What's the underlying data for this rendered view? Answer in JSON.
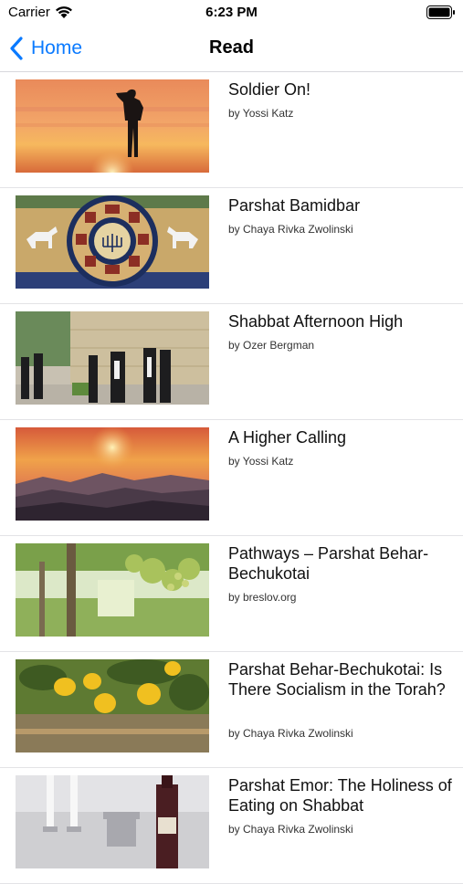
{
  "status": {
    "carrier": "Carrier",
    "time": "6:23 PM"
  },
  "nav": {
    "back_label": "Home",
    "title": "Read"
  },
  "articles": [
    {
      "title": "Soldier On!",
      "author": "by Yossi Katz",
      "image": "soldier-salute-sunset"
    },
    {
      "title": "Parshat Bamidbar",
      "author": "by Chaya Rivka Zwolinski",
      "image": "tribes-mosaic"
    },
    {
      "title": "Shabbat Afternoon High",
      "author": "by Ozer Bergman",
      "image": "jerusalem-street"
    },
    {
      "title": "A Higher Calling",
      "author": "by Yossi Katz",
      "image": "mountain-sunset"
    },
    {
      "title": "Pathways – Parshat Behar-Bechukotai",
      "author": "by breslov.org",
      "image": "orchard-path"
    },
    {
      "title": "Parshat Behar-Bechukotai: Is There Socialism in the Torah?",
      "author": "by Chaya Rivka Zwolinski",
      "image": "lemon-tree"
    },
    {
      "title": "Parshat Emor: The Holiness of Eating on Shabbat",
      "author": "by Chaya Rivka Zwolinski",
      "image": "shabbat-table"
    }
  ],
  "colors": {
    "accent": "#0a7aff",
    "separator": "#e3e3e6"
  }
}
